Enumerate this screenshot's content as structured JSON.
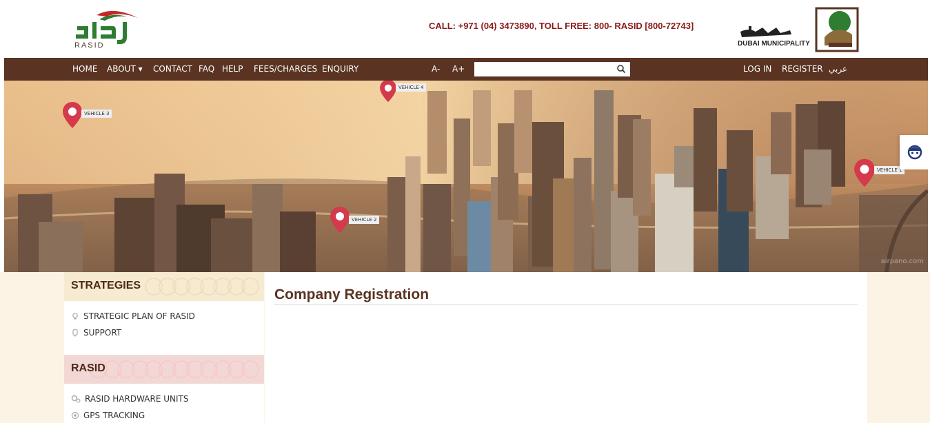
{
  "header": {
    "rasid_logo_text": "RASID",
    "call": "CALL: +971 (04) 3473890, TOLL FREE: 800- RASID [800-72743]",
    "dm_text": "DUBAI MUNICIPALITY"
  },
  "nav": {
    "home": "HOME",
    "about": "ABOUT ▾",
    "contact": "CONTACT",
    "faq": "FAQ",
    "help": "HELP",
    "fees": "FEES/CHARGES",
    "enquiry": "ENQUIRY",
    "font_down": "A-",
    "font_up": "A+",
    "search_placeholder": "",
    "login": "LOG IN",
    "register": "REGISTER",
    "arabic": "عربي"
  },
  "hero": {
    "markers": [
      {
        "label": "VEHICLE 3"
      },
      {
        "label": "VEHICLE 4"
      },
      {
        "label": "VEHICLE 2"
      },
      {
        "label": "VEHICLE 1"
      }
    ],
    "watermark": "airpano.com"
  },
  "sidebar": {
    "strategies_title": "STRATEGIES",
    "strategies_items": [
      "STRATEGIC PLAN OF RASID",
      "SUPPORT"
    ],
    "rasid_title": "RASID",
    "rasid_items": [
      "RASID HARDWARE UNITS",
      "GPS TRACKING"
    ]
  },
  "main": {
    "title": "Company Registration"
  },
  "colors": {
    "nav_bg": "#5a3322",
    "accent_red": "#8b1a1a",
    "body_bg": "#fdf3e4"
  }
}
